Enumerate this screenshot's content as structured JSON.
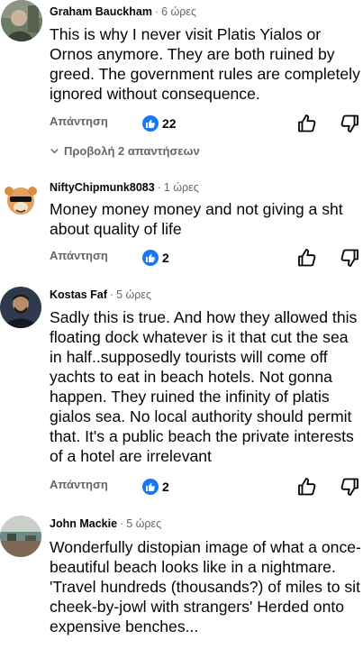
{
  "comments": [
    {
      "author": "Graham Bauckham",
      "time": "6 ώρες",
      "text": "This is why I never visit Platis Yialos or Ornos anymore. They are both ruined by greed. The government rules are completely ignored without consequence.",
      "reply_label": "Απάντηση",
      "likes": "22",
      "view_replies": "Προβολή 2 απαντήσεων"
    },
    {
      "author": "NiftyChipmunk8083",
      "time": "1 ώρες",
      "text": "Money money money and not giving a sht about quality of life",
      "reply_label": "Απάντηση",
      "likes": "2"
    },
    {
      "author": "Kostas Faf",
      "time": "5 ώρες",
      "text": "Sadly this is true. And how they allowed this floating dock whatever is it that cut the sea in half..supposedly tourists will come off yachts to eat in beach hotels. Not gonna happen. They ruined the infinity of platis gialos sea. No local authority should permit that. It's a public beach the private interests of a hotel are irrelevant",
      "reply_label": "Απάντηση",
      "likes": "2"
    },
    {
      "author": "John Mackie",
      "time": "5 ώρες",
      "text": "Wonderfully distopian image of what a once-beautiful beach looks like in a nightmare. 'Travel hundreds (thousands?) of miles to sit cheek-by-jowl with strangers' Herded onto expensive benches..."
    }
  ],
  "separator": "·",
  "icons": {
    "like_badge": "thumbs-up-badge-icon",
    "like": "thumbs-up-outline-icon",
    "dislike": "thumbs-down-outline-icon",
    "expand": "chevron-down-icon"
  },
  "colors": {
    "accent": "#1877f2",
    "secondary_text": "#65676b",
    "primary_text": "#050505"
  }
}
